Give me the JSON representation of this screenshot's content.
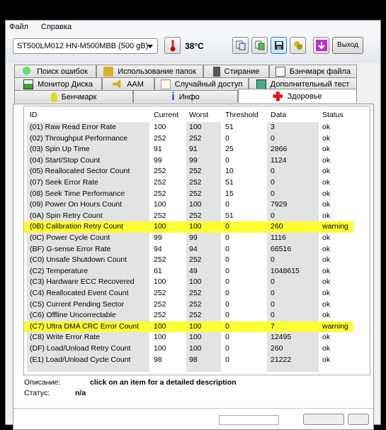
{
  "menu": {
    "file": "Файл",
    "help": "Справка"
  },
  "toolbar": {
    "drive": "ST500LM012 HN-M500MBB (500 gB)",
    "temperature": "38°C",
    "exit_label": "Выход",
    "icons": [
      "copy-text-icon",
      "copy-image-icon",
      "save-icon",
      "options-icon",
      "download-icon"
    ]
  },
  "tabs": {
    "row1": [
      "Поиск ошибок",
      "Использование папок",
      "Стирание",
      "Бэнчмарк файла"
    ],
    "row2": [
      "Монитор Диска",
      "AAM",
      "Случайный доступ",
      "Дополнительный  тест"
    ],
    "row3": [
      "Бенчмарк",
      "Инфо",
      "Здоровье"
    ],
    "active": "Здоровье"
  },
  "table": {
    "headers": [
      "ID",
      "Current",
      "Worst",
      "Threshold",
      "Data",
      "Status"
    ],
    "rows": [
      [
        "(01) Raw Read Error Rate",
        "100",
        "100",
        "51",
        "3",
        "ok"
      ],
      [
        "(02) Throughput Performance",
        "252",
        "252",
        "0",
        "0",
        "ok"
      ],
      [
        "(03) Spin Up Time",
        "91",
        "91",
        "25",
        "2866",
        "ok"
      ],
      [
        "(04) Start/Stop Count",
        "99",
        "99",
        "0",
        "1124",
        "ok"
      ],
      [
        "(05) Reallocated Sector Count",
        "252",
        "252",
        "10",
        "0",
        "ok"
      ],
      [
        "(07) Seek Error Rate",
        "252",
        "252",
        "51",
        "0",
        "ok"
      ],
      [
        "(08) Seek Time Performance",
        "252",
        "252",
        "15",
        "0",
        "ok"
      ],
      [
        "(09) Power On Hours Count",
        "100",
        "100",
        "0",
        "7929",
        "ok"
      ],
      [
        "(0A) Spin Retry Count",
        "252",
        "252",
        "51",
        "0",
        "ok"
      ],
      [
        "(0B) Calibration Retry Count",
        "100",
        "100",
        "0",
        "260",
        "warning"
      ],
      [
        "(0C) Power Cycle Count",
        "99",
        "99",
        "0",
        "1116",
        "ok"
      ],
      [
        "(BF) G-sense Error Rate",
        "94",
        "94",
        "0",
        "66516",
        "ok"
      ],
      [
        "(C0) Unsafe Shutdown Count",
        "252",
        "252",
        "0",
        "0",
        "ok"
      ],
      [
        "(C2) Temperature",
        "61",
        "49",
        "0",
        "1048615",
        "ok"
      ],
      [
        "(C3) Hardware ECC Recovered",
        "100",
        "100",
        "0",
        "0",
        "ok"
      ],
      [
        "(C4) Reallocated Event Count",
        "252",
        "252",
        "0",
        "0",
        "ok"
      ],
      [
        "(C5) Current Pending Sector",
        "252",
        "252",
        "0",
        "0",
        "ok"
      ],
      [
        "(C6) Offline Uncorrectable",
        "252",
        "252",
        "0",
        "0",
        "ok"
      ],
      [
        "(C7) Ultra DMA CRC Error Count",
        "100",
        "100",
        "0",
        "7",
        "warning"
      ],
      [
        "(C8) Write Error Rate",
        "100",
        "100",
        "0",
        "12495",
        "ok"
      ],
      [
        "(DF) Load/Unload Retry Count",
        "100",
        "100",
        "0",
        "260",
        "ok"
      ],
      [
        "(E1) Load/Unload Cycle Count",
        "98",
        "98",
        "0",
        "21222",
        "ok"
      ]
    ],
    "warning_color": "#ffff33"
  },
  "details": {
    "description_label": "Описание:",
    "description": "click on an item for a detailed description",
    "status_label": "Статус:",
    "status": "n/a"
  }
}
